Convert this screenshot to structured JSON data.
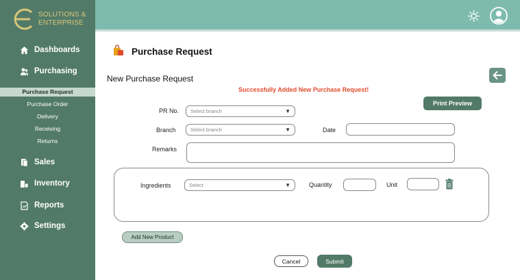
{
  "brand": {
    "line1": "SOLUTIONS &",
    "line2": "ENTERPRISE"
  },
  "sidebar": {
    "items": [
      {
        "label": "Dashboards",
        "icon": "home-icon"
      },
      {
        "label": "Purchasing",
        "icon": "users-icon"
      },
      {
        "label": "Sales",
        "icon": "document-icon"
      },
      {
        "label": "Inventory",
        "icon": "inventory-icon"
      },
      {
        "label": "Reports",
        "icon": "chart-icon"
      },
      {
        "label": "Settings",
        "icon": "gear-icon"
      }
    ],
    "subitems": [
      {
        "label": "Purchase Request",
        "active": true
      },
      {
        "label": "Purchase Order"
      },
      {
        "label": "Delivery"
      },
      {
        "label": "Receiving"
      },
      {
        "label": "Returns"
      }
    ]
  },
  "header": {
    "icons": [
      "sun-icon",
      "user-avatar-icon"
    ]
  },
  "page": {
    "title": "Purchase Request",
    "subtitle": "New Purchase Request",
    "success_message": "Successfully Added New Purchase Request!",
    "print_preview": "Print Preview"
  },
  "form": {
    "pr_label": "PR No.",
    "pr_placeholder": "Select branch",
    "branch_label": "Branch",
    "branch_placeholder": "Select branch",
    "date_label": "Date",
    "remarks_label": "Remarks",
    "ingredients_label": "Ingredients",
    "ingredients_placeholder": "Select",
    "quantity_label": "Quantity",
    "unit_label": "Unit",
    "add_product": "Add New Product",
    "cancel": "Cancel",
    "submit": "Submit"
  },
  "colors": {
    "sidebar": "#527a68",
    "topbar": "#7ebbae",
    "accent": "#e04b2d",
    "brand_gold": "#d8c779"
  }
}
